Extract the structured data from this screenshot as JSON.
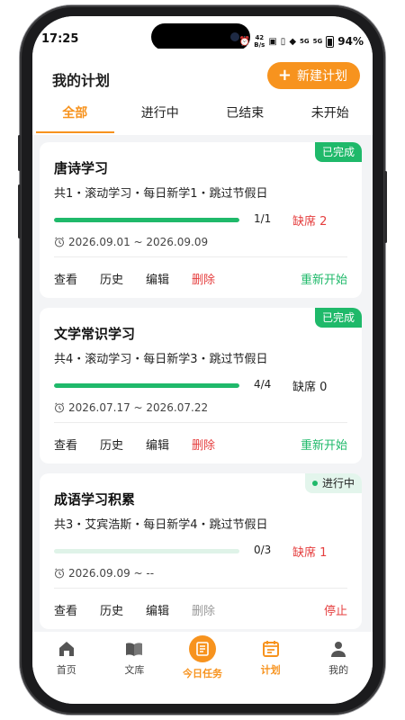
{
  "status_bar": {
    "time": "17:25",
    "speed_value": "42",
    "speed_unit": "B/s",
    "net_5g_1": "5G",
    "net_5g_2": "5G",
    "battery": "94%"
  },
  "header": {
    "title": "我的计划",
    "new_button_label": "新建计划"
  },
  "tabs": [
    {
      "label": "全部",
      "active": true
    },
    {
      "label": "进行中",
      "active": false
    },
    {
      "label": "已结束",
      "active": false
    },
    {
      "label": "未开始",
      "active": false
    }
  ],
  "plans": [
    {
      "title": "唐诗学习",
      "status": "已完成",
      "meta": "共1・滚动学习・每日新学1・跳过节假日",
      "progress": 1.0,
      "ratio": "1/1",
      "absent": "缺席 2",
      "dates": "2026.09.01 ~ 2026.09.09",
      "actions": {
        "view": "查看",
        "history": "历史",
        "edit": "编辑",
        "delete": "删除",
        "primary": "重新开始"
      }
    },
    {
      "title": "文学常识学习",
      "status": "已完成",
      "meta": "共4・滚动学习・每日新学3・跳过节假日",
      "progress": 1.0,
      "ratio": "4/4",
      "absent": "缺席 0",
      "dates": "2026.07.17 ~ 2026.07.22",
      "actions": {
        "view": "查看",
        "history": "历史",
        "edit": "编辑",
        "delete": "删除",
        "primary": "重新开始"
      }
    },
    {
      "title": "成语学习积累",
      "status": "进行中",
      "meta": "共3・艾宾浩斯・每日新学4・跳过节假日",
      "progress": 0.0,
      "ratio": "0/3",
      "absent": "缺席 1",
      "dates": "2026.09.09 ~ --",
      "actions": {
        "view": "查看",
        "history": "历史",
        "edit": "编辑",
        "delete": "删除",
        "primary": "停止"
      }
    }
  ],
  "bottom_nav": {
    "home": "首页",
    "library": "文库",
    "today": "今日任务",
    "plan": "计划",
    "mine": "我的"
  },
  "colors": {
    "accent": "#f7931e",
    "success": "#1fb96a",
    "danger": "#e53e3e"
  }
}
